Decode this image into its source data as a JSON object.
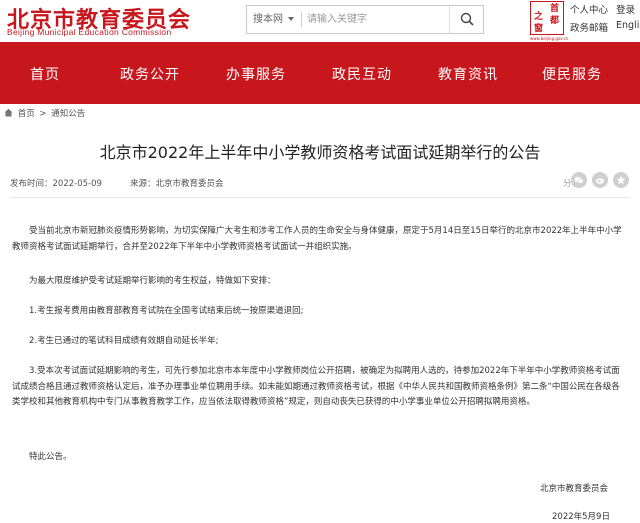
{
  "header": {
    "logo_cn": "北京市教育委员会",
    "logo_en": "Beijing Municipal Education Commission",
    "search": {
      "scope": "搜本网",
      "placeholder": "请输入关键字"
    },
    "seal": {
      "chars": [
        "首",
        "都",
        "之",
        "窗"
      ],
      "subtitle": "www.beijing.gov.cn"
    },
    "links": [
      "个人中心",
      "登录",
      "政务邮箱",
      "English"
    ]
  },
  "nav": {
    "items": [
      "首页",
      "政务公开",
      "办事服务",
      "政民互动",
      "教育资讯",
      "便民服务"
    ]
  },
  "breadcrumb": {
    "items": [
      "首页",
      "通知公告"
    ],
    "separator": ">"
  },
  "article": {
    "title": "北京市2022年上半年中小学教师资格考试面试延期举行的公告",
    "publish_time": "发布时间：2022-05-09",
    "source": "来源：北京市教育委员会",
    "share_label": "分享：",
    "paragraphs": [
      "受当前北京市新冠肺炎疫情形势影响，为切实保障广大考生和涉考工作人员的生命安全与身体健康，原定于5月14日至15日举行的北京市2022年上半年中小学教师资格考试面试延期举行，合并至2022年下半年中小学教师资格考试面试一并组织实施。",
      "为最大限度维护受考试延期举行影响的考生权益，特做如下安排：",
      "1.考生报考费用由教育部教育考试院在全国考试结束后统一按原渠道退回;",
      "2.考生已通过的笔试科目成绩有效期自动延长半年;",
      "3.受本次考试面试延期影响的考生，可先行参加北京市本年度中小学教师岗位公开招聘，被确定为拟聘用人选的，待参加2022年下半年中小学教师资格考试面试成绩合格且通过教师资格认定后，准予办理事业单位聘用手续。如未能如期通过教师资格考试，根据《中华人民共和国教师资格条例》第二条“中国公民在各级各类学校和其他教育机构中专门从事教育教学工作，应当依法取得教师资格”规定，则自动丧失已获得的中小学事业单位公开招聘拟聘用资格。",
      "特此公告。"
    ],
    "signature": "北京市教育委员会",
    "date": "2022年5月9日"
  }
}
